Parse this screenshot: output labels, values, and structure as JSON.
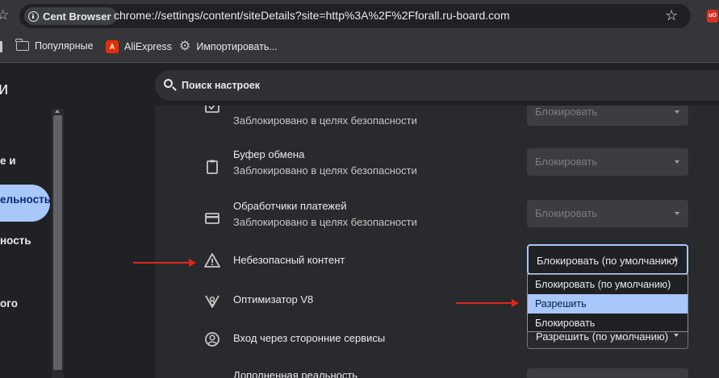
{
  "browser": {
    "site_chip": "Cent Browser",
    "url": "chrome://settings/content/siteDetails?site=http%3A%2F%2Fforall.ru-board.com",
    "extension_badge": "uO"
  },
  "bookmarks": {
    "items": [
      {
        "label": "Популярные",
        "icon": "folder-icon"
      },
      {
        "label": "AliExpress",
        "icon": "aliexpress-icon"
      },
      {
        "label": "Импортировать...",
        "icon": "gear-icon"
      }
    ]
  },
  "settings": {
    "title": "и",
    "search_placeholder": "Поиск настроек",
    "nav": {
      "item_a": "е и",
      "item_active": "ельность и",
      "item_c": "ность",
      "item_d": "ого"
    },
    "rows": [
      {
        "title": "",
        "subtitle": "Заблокировано в целях безопасности",
        "select": "Блокировать",
        "icon": "window-icon"
      },
      {
        "title": "Буфер обмена",
        "subtitle": "Заблокировано в целях безопасности",
        "select": "Блокировать",
        "icon": "clipboard-icon"
      },
      {
        "title": "Обработчики платежей",
        "subtitle": "Заблокировано в целях безопасности",
        "select": "Блокировать",
        "icon": "credit-card-icon"
      },
      {
        "title": "Небезопасный контент",
        "subtitle": "",
        "select": "Блокировать (по умолчанию)",
        "icon": "warning-icon"
      },
      {
        "title": "Оптимизатор V8",
        "subtitle": "",
        "select": "",
        "icon": "v8-icon"
      },
      {
        "title": "Вход через сторонние сервисы",
        "subtitle": "",
        "select": "Разрешить (по умолчанию)",
        "icon": "account-icon"
      },
      {
        "title": "Дополненная реальность",
        "subtitle": "",
        "select": "",
        "icon": "ar-icon"
      }
    ],
    "dropdown_options": [
      "Блокировать (по умолчанию)",
      "Разрешить",
      "Блокировать"
    ]
  },
  "colors": {
    "accent": "#a8c7fa",
    "annotation_arrow": "#e1251b"
  }
}
